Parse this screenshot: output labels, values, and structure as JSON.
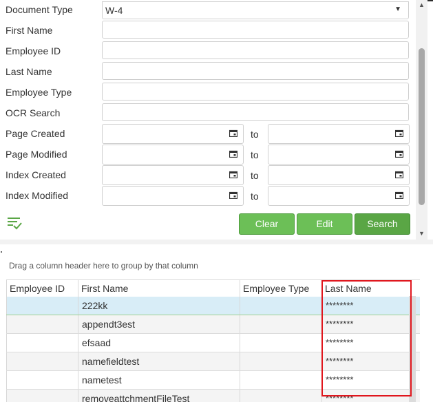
{
  "form": {
    "document_type": {
      "label": "Document Type",
      "value": "W-4"
    },
    "first_name": {
      "label": "First Name",
      "value": ""
    },
    "employee_id": {
      "label": "Employee ID",
      "value": ""
    },
    "last_name": {
      "label": "Last Name",
      "value": ""
    },
    "employee_type": {
      "label": "Employee Type",
      "value": ""
    },
    "ocr_search": {
      "label": "OCR Search",
      "value": ""
    },
    "page_created": {
      "label": "Page Created",
      "to": "to"
    },
    "page_modified": {
      "label": "Page Modified",
      "to": "to"
    },
    "index_created": {
      "label": "Index Created",
      "to": "to"
    },
    "index_modified": {
      "label": "Index Modified",
      "to": "to"
    }
  },
  "buttons": {
    "clear": "Clear",
    "edit": "Edit",
    "search": "Search"
  },
  "grid": {
    "group_hint": "Drag a column header here to group by that column",
    "columns": [
      "Employee ID",
      "First Name",
      "Employee Type",
      "Last Name"
    ],
    "rows": [
      {
        "employee_id": "",
        "first_name": "222kk",
        "employee_type": "",
        "last_name": "********"
      },
      {
        "employee_id": "",
        "first_name": "appendt3est",
        "employee_type": "",
        "last_name": "********"
      },
      {
        "employee_id": "",
        "first_name": "efsaad",
        "employee_type": "",
        "last_name": "********"
      },
      {
        "employee_id": "",
        "first_name": "namefieldtest",
        "employee_type": "",
        "last_name": "********"
      },
      {
        "employee_id": "",
        "first_name": "nametest",
        "employee_type": "",
        "last_name": "********"
      },
      {
        "employee_id": "",
        "first_name": "removeattchmentFileTest",
        "employee_type": "",
        "last_name": "********"
      }
    ]
  },
  "colors": {
    "button_green": "#6cbf57",
    "selected_row": "#d8edf7",
    "highlight_red": "#e0161d"
  },
  "icons": {
    "date": "calendar-icon",
    "checklist": "checklist-icon",
    "dropdown": "chevron-down-icon"
  }
}
